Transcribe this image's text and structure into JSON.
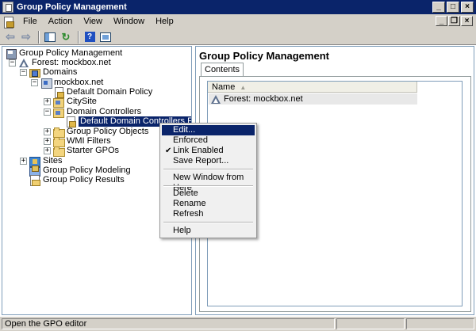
{
  "window": {
    "title": "Group Policy Management"
  },
  "menubar": {
    "items": [
      "File",
      "Action",
      "View",
      "Window",
      "Help"
    ]
  },
  "toolbar": {
    "buttons": [
      "back-arrow-icon",
      "forward-arrow-icon",
      "show-hide-tree-icon",
      "refresh-icon",
      "help-icon",
      "properties-icon"
    ]
  },
  "tree": {
    "root": "Group Policy Management",
    "forest": "Forest: mockbox.net",
    "domains": "Domains",
    "domain": "mockbox.net",
    "default_domain_policy": "Default Domain Policy",
    "citysite": "CitySite",
    "domain_controllers": "Domain Controllers",
    "default_dc_policy": "Default Domain Controllers Policy",
    "gpo_objects": "Group Policy Objects",
    "wmi_filters": "WMI Filters",
    "starter_gpos": "Starter GPOs",
    "sites": "Sites",
    "modeling": "Group Policy Modeling",
    "results": "Group Policy Results"
  },
  "right_pane": {
    "title": "Group Policy Management",
    "tab": "Contents",
    "column_name": "Name",
    "rows": [
      "Forest: mockbox.net"
    ]
  },
  "context_menu": {
    "edit": "Edit...",
    "enforced": "Enforced",
    "link_enabled": "Link Enabled",
    "save_report": "Save Report...",
    "new_window": "New Window from Here",
    "delete": "Delete",
    "rename": "Rename",
    "refresh": "Refresh",
    "help": "Help"
  },
  "statusbar": {
    "text": "Open the GPO editor"
  }
}
